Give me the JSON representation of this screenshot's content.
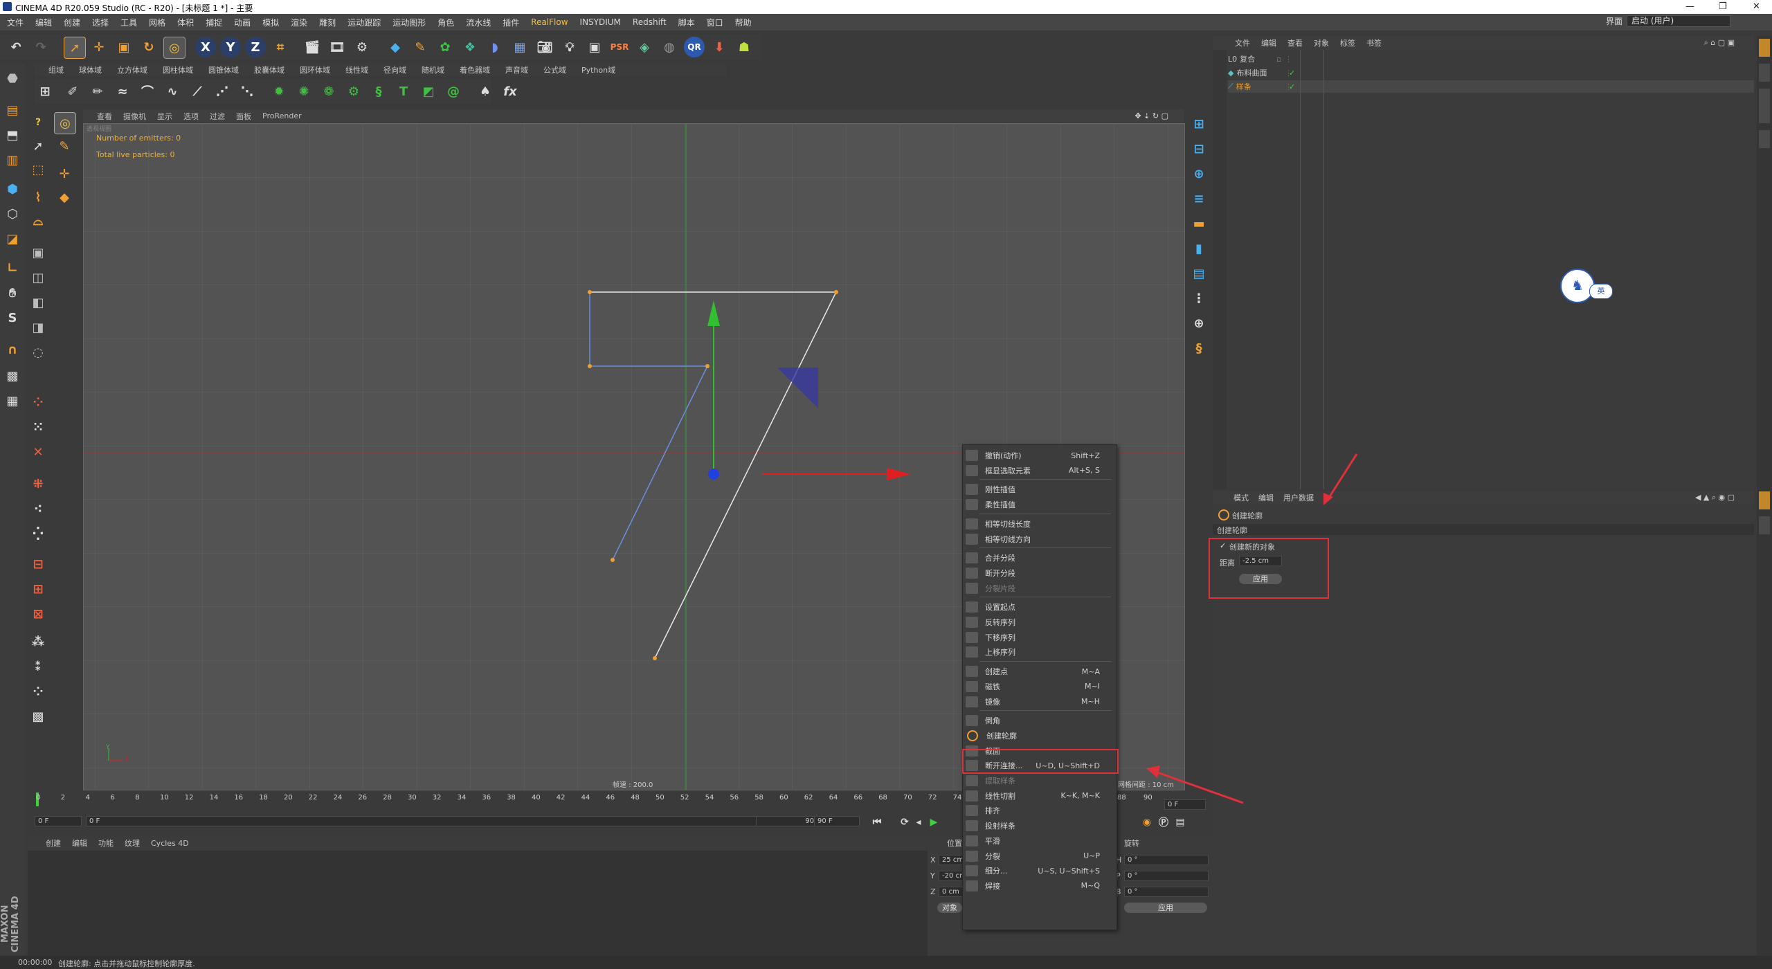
{
  "app": {
    "title": "CINEMA 4D R20.059 Studio (RC - R20) - [未标题 1 *] - 主要",
    "layout_label": "界面",
    "layout_value": "启动 (用户)"
  },
  "menubar": [
    "文件",
    "编辑",
    "创建",
    "选择",
    "工具",
    "网格",
    "体积",
    "捕捉",
    "动画",
    "模拟",
    "渲染",
    "雕刻",
    "运动跟踪",
    "运动图形",
    "角色",
    "流水线",
    "插件",
    "RealFlow",
    "INSYDIUM",
    "Redshift",
    "脚本",
    "窗口",
    "帮助"
  ],
  "fieldbar": [
    "组域",
    "球体域",
    "立方体域",
    "圆柱体域",
    "圆锥体域",
    "胶囊体域",
    "圆环体域",
    "线性域",
    "径向域",
    "随机域",
    "着色器域",
    "声音域",
    "公式域",
    "Python域"
  ],
  "viewport": {
    "menu": [
      "查看",
      "摄像机",
      "显示",
      "选项",
      "过滤",
      "面板",
      "ProRender"
    ],
    "hud": [
      "Number of emitters: 0",
      "Total live particles: 0"
    ],
    "speed": "帧速 : 200.0",
    "grid_spacing": "网格间距 : 10 cm",
    "axis_y": "Y",
    "axis_x": "X",
    "view_label": "透视视图"
  },
  "timeline": {
    "ticks": [
      "0",
      "2",
      "4",
      "6",
      "8",
      "10",
      "12",
      "14",
      "16",
      "18",
      "20",
      "22",
      "24",
      "26",
      "28",
      "30",
      "32",
      "34",
      "36",
      "38",
      "40",
      "42",
      "44",
      "46",
      "48",
      "50",
      "52",
      "54",
      "56",
      "58",
      "60",
      "62",
      "64",
      "66",
      "68",
      "70",
      "72",
      "74",
      "88",
      "90"
    ],
    "start": "0 F",
    "current": "0 F",
    "end": "90 F",
    "end2": "90 F",
    "right_field": "0 F"
  },
  "materials": {
    "menu": [
      "创建",
      "编辑",
      "功能",
      "纹理",
      "Cycles 4D"
    ]
  },
  "statusbar": {
    "time": "00:00:00",
    "message": "创建轮廓: 点击并拖动鼠标控制轮廓厚度."
  },
  "coords": {
    "header_left": "位置",
    "header_right": "旋转",
    "rows": [
      {
        "axis": "X",
        "pos": "25 cm",
        "rot_axis": "H",
        "rot": "0 °"
      },
      {
        "axis": "Y",
        "pos": "-20 cm",
        "rot_axis": "P",
        "rot": "0 °"
      },
      {
        "axis": "Z",
        "pos": "0 cm",
        "rot_axis": "B",
        "rot": "0 °"
      }
    ],
    "object_btn": "对象",
    "apply_btn": "应用"
  },
  "object_manager": {
    "menu": [
      "文件",
      "编辑",
      "查看",
      "对象",
      "标签",
      "书签"
    ],
    "items": [
      {
        "name": "复合",
        "selected": false
      },
      {
        "name": "布料曲面",
        "selected": false
      },
      {
        "name": "样条",
        "selected": true
      }
    ]
  },
  "attributes": {
    "menu": [
      "模式",
      "编辑",
      "用户数据"
    ],
    "tool_name": "创建轮廓",
    "section": "创建轮廓",
    "checkbox_label": "创建新的对象",
    "checkbox_checked": true,
    "distance_label": "距离",
    "distance_value": "-2.5 cm",
    "apply": "应用"
  },
  "context_menu": {
    "items": [
      {
        "label": "撤销(动作)",
        "shortcut": "Shift+Z",
        "disabled": false
      },
      {
        "label": "框显选取元素",
        "shortcut": "Alt+S, S",
        "disabled": false
      },
      {
        "sep": true
      },
      {
        "label": "刚性插值",
        "shortcut": "",
        "disabled": false
      },
      {
        "label": "柔性插值",
        "shortcut": "",
        "disabled": false
      },
      {
        "sep": true
      },
      {
        "label": "相等切线长度",
        "shortcut": "",
        "disabled": false
      },
      {
        "label": "相等切线方向",
        "shortcut": "",
        "disabled": false
      },
      {
        "sep": true
      },
      {
        "label": "合并分段",
        "shortcut": "",
        "disabled": false
      },
      {
        "label": "断开分段",
        "shortcut": "",
        "disabled": false
      },
      {
        "label": "分裂片段",
        "shortcut": "",
        "disabled": true
      },
      {
        "sep": true
      },
      {
        "label": "设置起点",
        "shortcut": "",
        "disabled": false
      },
      {
        "label": "反转序列",
        "shortcut": "",
        "disabled": false
      },
      {
        "label": "下移序列",
        "shortcut": "",
        "disabled": false
      },
      {
        "label": "上移序列",
        "shortcut": "",
        "disabled": false
      },
      {
        "sep": true
      },
      {
        "label": "创建点",
        "shortcut": "M~A",
        "disabled": false
      },
      {
        "label": "磁铁",
        "shortcut": "M~I",
        "disabled": false
      },
      {
        "label": "镜像",
        "shortcut": "M~H",
        "disabled": false
      },
      {
        "sep": true
      },
      {
        "label": "倒角",
        "shortcut": "",
        "disabled": false
      },
      {
        "label": "创建轮廓",
        "shortcut": "",
        "disabled": false,
        "highlight": true
      },
      {
        "label": "截面",
        "shortcut": "",
        "disabled": false
      },
      {
        "label": "断开连接...",
        "shortcut": "U~D, U~Shift+D",
        "disabled": false
      },
      {
        "label": "提取样条",
        "shortcut": "",
        "disabled": true
      },
      {
        "label": "线性切割",
        "shortcut": "K~K, M~K",
        "disabled": false
      },
      {
        "label": "排齐",
        "shortcut": "",
        "disabled": false
      },
      {
        "label": "投射样条",
        "shortcut": "",
        "disabled": false
      },
      {
        "label": "平滑",
        "shortcut": "",
        "disabled": false
      },
      {
        "label": "分裂",
        "shortcut": "U~P",
        "disabled": false
      },
      {
        "label": "细分...",
        "shortcut": "U~S, U~Shift+S",
        "disabled": false
      },
      {
        "label": "焊接",
        "shortcut": "M~Q",
        "disabled": false
      }
    ]
  },
  "ime": {
    "label": "英"
  },
  "brand": "MAXON CINEMA 4D",
  "colors": {
    "accent_orange": "#e8a030",
    "highlight_red": "#e0303a",
    "spline_selected": "#6a8fdc",
    "axis_green": "#30c030",
    "axis_red": "#e02020"
  }
}
